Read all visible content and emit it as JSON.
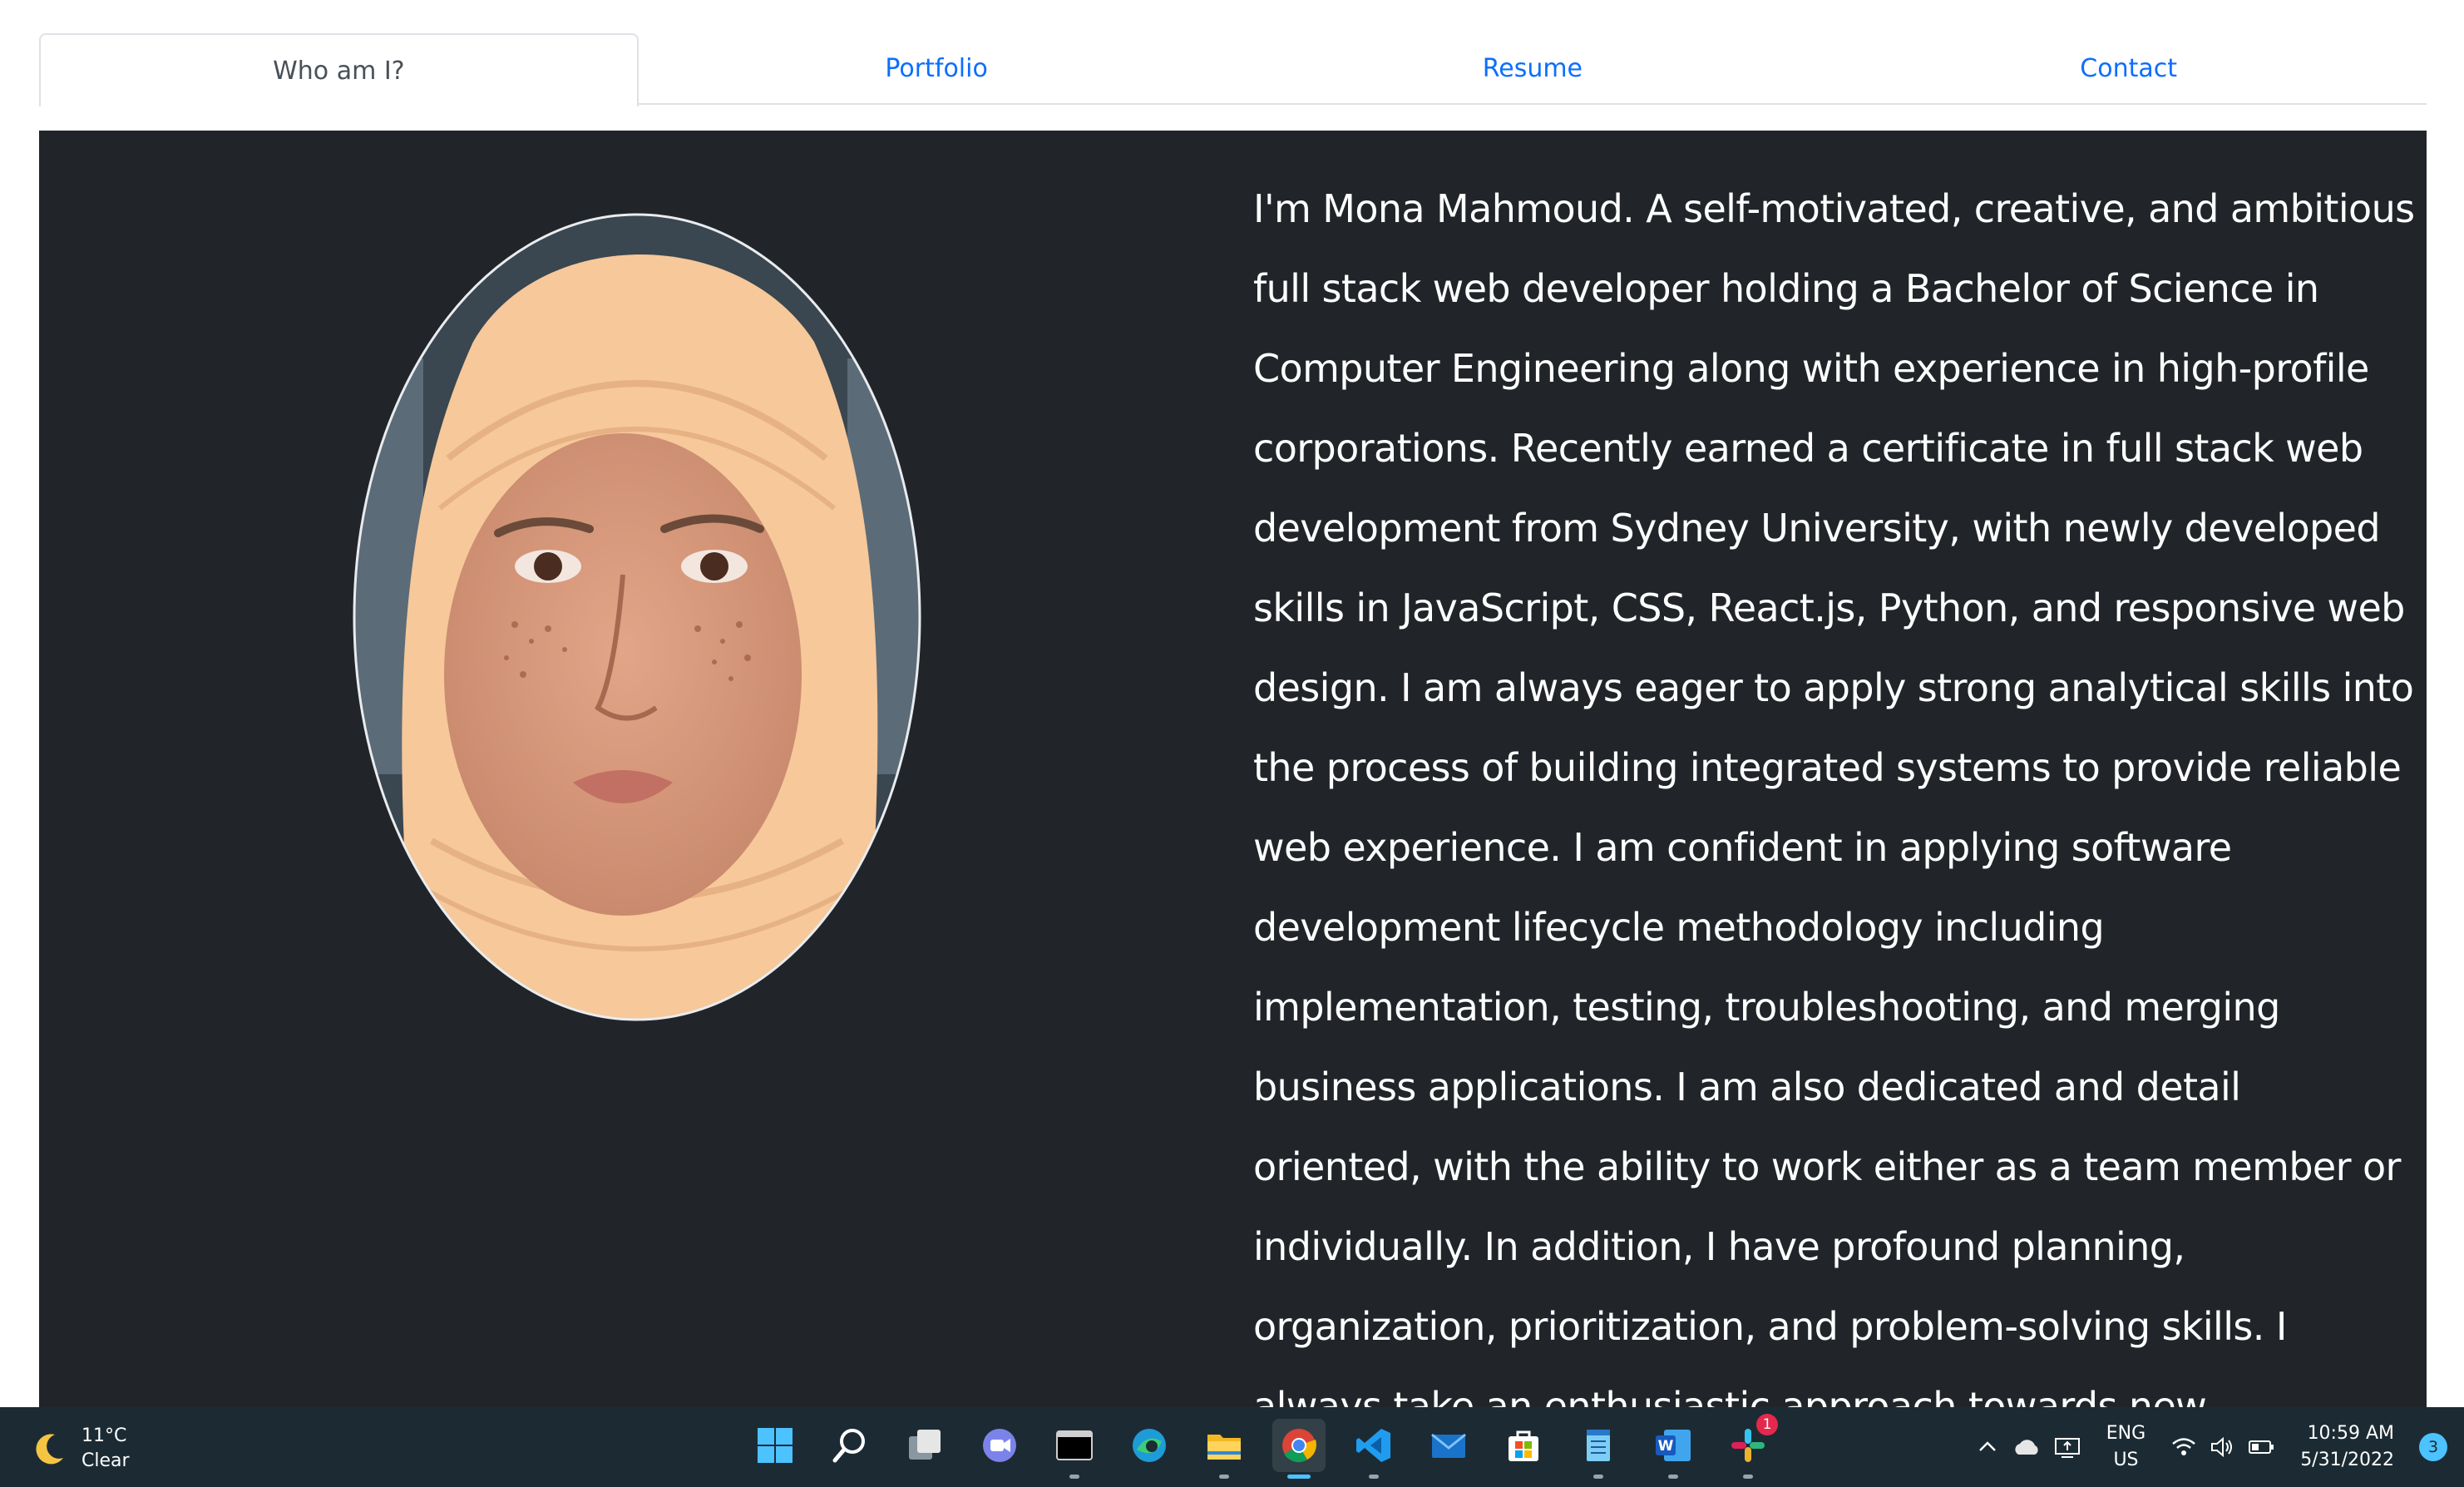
{
  "tabs": [
    {
      "label": "Who am I?",
      "active": true
    },
    {
      "label": "Portfolio",
      "active": false
    },
    {
      "label": "Resume",
      "active": false
    },
    {
      "label": "Contact",
      "active": false
    }
  ],
  "bio": {
    "text": "I'm Mona Mahmoud. A self-motivated, creative, and ambitious full stack web developer holding a Bachelor of Science in Computer Engineering along with experience in high-profile corporations. Recently earned a certificate in full stack web development from Sydney University, with newly developed skills in JavaScript, CSS, React.js, Python, and responsive web design. I am always eager to apply strong analytical skills into the process of building integrated systems to provide reliable web experience. I am confident in applying software development lifecycle methodology including implementation, testing, troubleshooting, and merging business applications. I am also dedicated and detail oriented, with the ability to work either as a team member or individually. In addition, I have profound planning, organization, prioritization, and problem-solving skills. I always take an enthusiastic approach towards new challenges, and I’m interested in learning new"
  },
  "taskbar": {
    "weather": {
      "temp": "11°C",
      "condition": "Clear",
      "icon": "moon-icon"
    },
    "apps": [
      {
        "name": "start-icon",
        "active": false,
        "running": false
      },
      {
        "name": "search-icon",
        "active": false,
        "running": false
      },
      {
        "name": "task-view-icon",
        "active": false,
        "running": false
      },
      {
        "name": "teams-chat-icon",
        "active": false,
        "running": false
      },
      {
        "name": "terminal-icon",
        "active": false,
        "running": true
      },
      {
        "name": "edge-icon",
        "active": false,
        "running": false
      },
      {
        "name": "file-explorer-icon",
        "active": false,
        "running": true
      },
      {
        "name": "chrome-icon",
        "active": true,
        "running": true
      },
      {
        "name": "vscode-icon",
        "active": false,
        "running": true
      },
      {
        "name": "mail-icon",
        "active": false,
        "running": false
      },
      {
        "name": "store-icon",
        "active": false,
        "running": false
      },
      {
        "name": "notepad-icon",
        "active": false,
        "running": true
      },
      {
        "name": "word-icon",
        "active": false,
        "running": true
      },
      {
        "name": "slack-icon",
        "active": false,
        "running": true,
        "badge": "1"
      }
    ],
    "language": {
      "line1": "ENG",
      "line2": "US"
    },
    "clock": {
      "time": "10:59 AM",
      "date": "5/31/2022"
    },
    "notifications": "3"
  },
  "colors": {
    "panel": "#212529",
    "link": "#0d6efd",
    "active_tab_text": "#495057",
    "taskbar": "#1c2b33"
  }
}
